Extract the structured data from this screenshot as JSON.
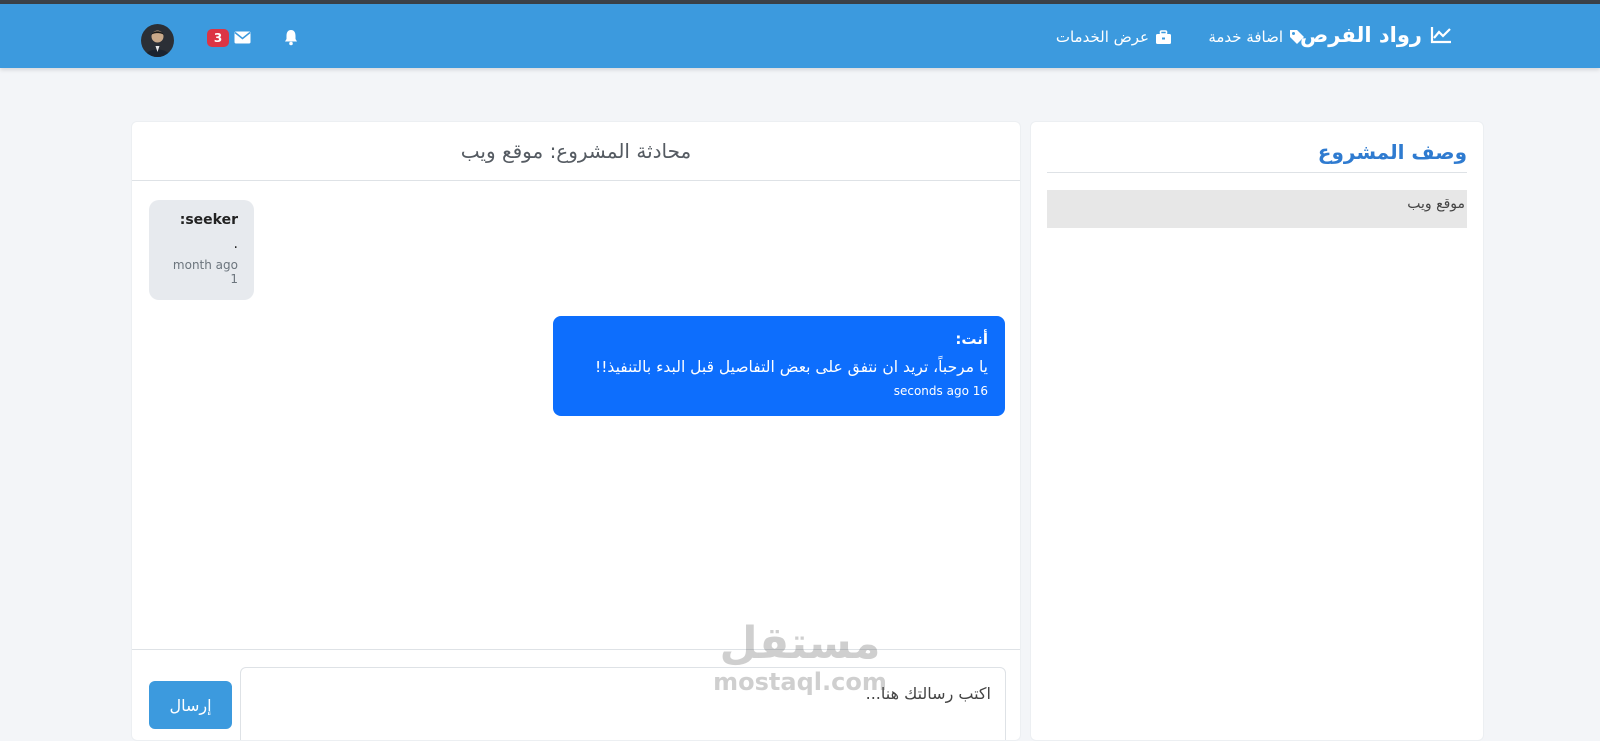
{
  "navbar": {
    "brand": "رواد الفرص",
    "links": [
      {
        "label": "اضافة خدمة",
        "icon": "tag-icon"
      },
      {
        "label": "عرض الخدمات",
        "icon": "briefcase-icon"
      }
    ],
    "notifications_icon": "bell-icon",
    "messages_icon": "envelope-icon",
    "messages_count": "3",
    "avatar": "user-avatar"
  },
  "chat": {
    "title": "محادثة المشروع: موقع ويب",
    "messages": [
      {
        "author": ":seeker",
        "text": ".",
        "time": "month ago 1",
        "side": "left"
      },
      {
        "author": "أنت:",
        "text": "يا مرحباً، تريد ان نتفق على بعض التفاصيل قبل البدء بالتنفيذ!!",
        "time": "seconds ago 16",
        "side": "right"
      }
    ],
    "input_placeholder": "اكتب رسالتك هنا...",
    "send_label": "إرسال"
  },
  "description": {
    "title": "وصف المشروع",
    "text": "موقع ويب"
  },
  "watermark": {
    "arabic": "مستقل",
    "latin": "mostaql.com"
  },
  "colors": {
    "navbar": "#3c9ade",
    "own_message": "#0d6efd",
    "other_message": "#e7eaee",
    "badge": "#dc3545",
    "section_title": "#2f7bd0"
  }
}
